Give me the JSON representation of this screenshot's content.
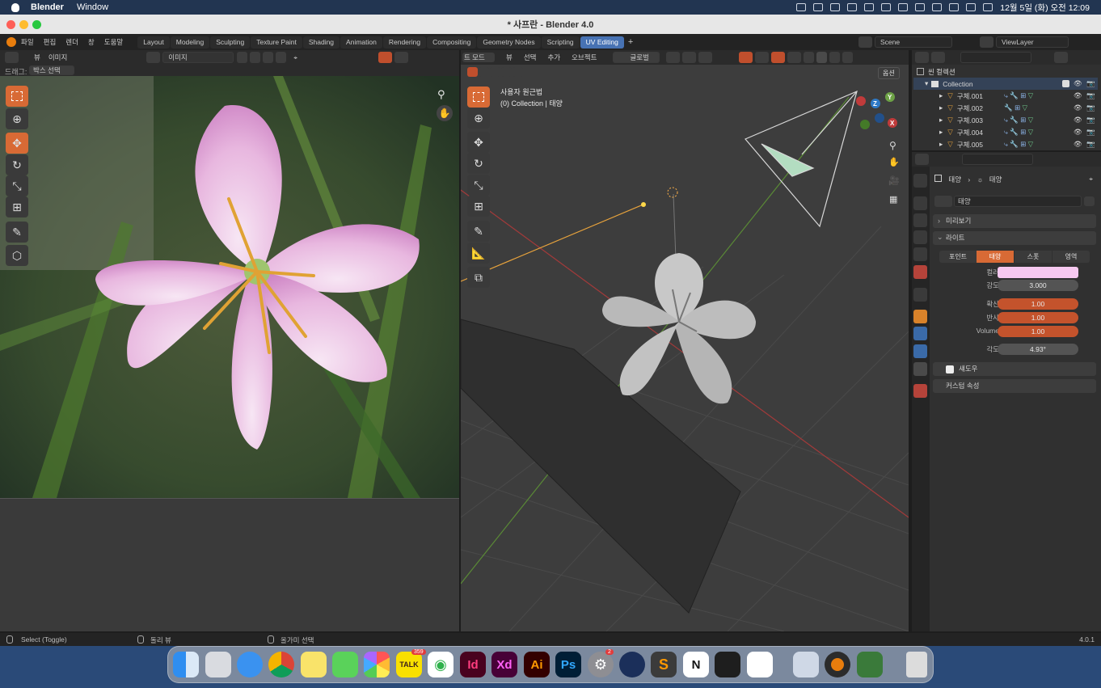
{
  "menubar": {
    "apple": "",
    "app": "Blender",
    "window": "Window",
    "datetime": "12월 5일 (화) 오전 12:09"
  },
  "window": {
    "title": "* 사프란 - Blender 4.0"
  },
  "topbar": {
    "menus": [
      "파일",
      "편집",
      "렌더",
      "창",
      "도움말"
    ],
    "workspaces": [
      "Layout",
      "Modeling",
      "Sculpting",
      "Texture Paint",
      "Shading",
      "Animation",
      "Rendering",
      "Compositing",
      "Geometry Nodes",
      "Scripting",
      "UV Editing"
    ],
    "active_workspace": "UV Editing",
    "add_tab": "+",
    "scene": "Scene",
    "view_layer": "ViewLayer"
  },
  "image_editor": {
    "menus": [
      "뷰",
      "이미지"
    ],
    "image_name": "이미지",
    "drag_label": "드래그:",
    "drag_mode": "박스 선택"
  },
  "viewport": {
    "mode": "트 모드",
    "menus": [
      "뷰",
      "선택",
      "추가",
      "오브젝트"
    ],
    "orientation": "글로벌",
    "options_label": "옵션",
    "overlay_title": "사용자 원근법",
    "overlay_sub": "(0) Collection | 태양",
    "gizmo": {
      "x": "X",
      "y": "Y",
      "z": "Z"
    }
  },
  "outliner": {
    "scene_collection": "씬 컬렉션",
    "collection": "Collection",
    "objects": [
      "구체.001",
      "구체.002",
      "구체.003",
      "구체.004",
      "구체.005"
    ]
  },
  "properties": {
    "breadcrumb_a": "태양",
    "breadcrumb_b": "태양",
    "data_name": "태양",
    "panels": {
      "preview": "미리보기",
      "light": "라이트",
      "shadow": "섀도우",
      "custom": "커스텀 속성"
    },
    "light_types": [
      "포인트",
      "태양",
      "스폿",
      "영역"
    ],
    "active_light_type": "태양",
    "color_label": "컬러",
    "color_value": "#f6c8f0",
    "strength_label": "강도",
    "strength": "3.000",
    "diffuse_label": "확산",
    "diffuse": "1.00",
    "specular_label": "반사",
    "specular": "1.00",
    "volume_label": "Volume",
    "volume": "1.00",
    "angle_label": "각도",
    "angle": "4.93°"
  },
  "statusbar": {
    "select": "Select (Toggle)",
    "view": "돌리 뷰",
    "lasso": "올가미 선택",
    "version": "4.0.1"
  },
  "dock": {
    "kakao_badge": "359",
    "settings_badge": "2",
    "apps": [
      "Finder",
      "Launchpad",
      "Safari",
      "Chrome",
      "Notes",
      "Messages",
      "Photos",
      "KakaoTalk",
      "Maps",
      "InDesign",
      "Adobe XD",
      "Illustrator",
      "Photoshop",
      "System Settings",
      "Cinema 4D",
      "Sublime Text",
      "Notion",
      "Figma",
      "Slack",
      "Preview",
      "Blender",
      "Android Studio",
      "Trash"
    ],
    "labels": {
      "kakao": "TALK",
      "id": "Id",
      "xd": "Xd",
      "ai": "Ai",
      "ps": "Ps",
      "notion": "N"
    }
  }
}
